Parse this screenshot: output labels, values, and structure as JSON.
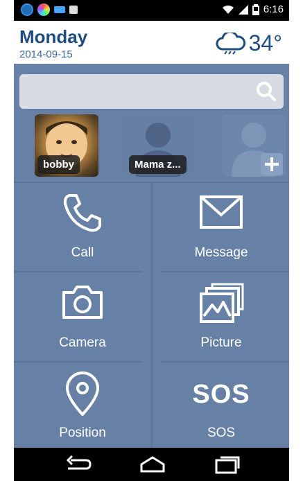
{
  "status_bar": {
    "time": "6:16",
    "icons": [
      "app-icon-blue",
      "app-icon-rainbow",
      "battery-small-icon",
      "image-icon"
    ],
    "right_icons": [
      "wifi-icon",
      "signal-icon",
      "battery-icon"
    ]
  },
  "header": {
    "day": "Monday",
    "date": "2014-09-15",
    "weather_icon": "rain-cloud-icon",
    "temperature": "34°"
  },
  "search": {
    "icon": "search-icon"
  },
  "contacts": [
    {
      "name": "bobby",
      "type": "photo"
    },
    {
      "name": "Mama z...",
      "type": "silhouette"
    },
    {
      "name": "",
      "type": "add-contact"
    }
  ],
  "grid": [
    {
      "label": "Call",
      "icon": "phone-icon"
    },
    {
      "label": "Message",
      "icon": "envelope-icon"
    },
    {
      "label": "Camera",
      "icon": "camera-icon"
    },
    {
      "label": "Picture",
      "icon": "gallery-icon"
    },
    {
      "label": "Position",
      "icon": "location-pin-icon"
    },
    {
      "label": "SOS",
      "icon": "sos-icon",
      "icon_text": "SOS"
    }
  ],
  "navbar": {
    "icons": [
      "back-icon",
      "home-icon",
      "recent-apps-icon"
    ]
  },
  "colors": {
    "background": "#6680a6",
    "header_text": "#1f4c7f",
    "search_bg": "#d7dbe3"
  }
}
